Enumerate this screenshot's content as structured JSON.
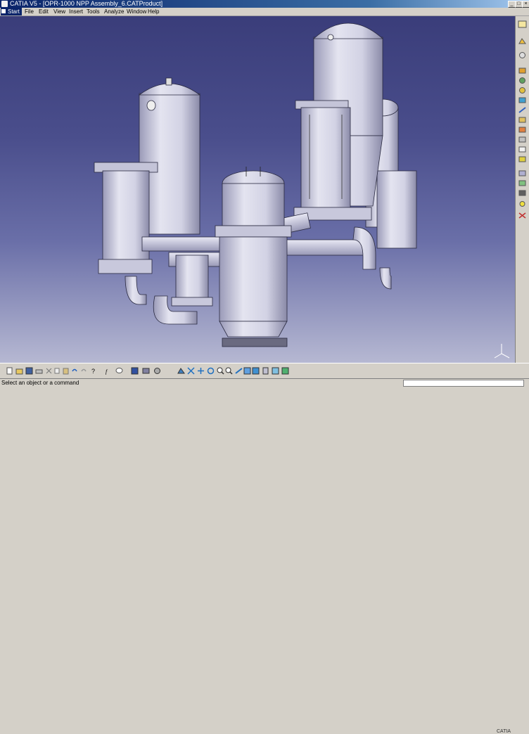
{
  "window": {
    "title": "CATIA V5 - [OPR-1000 NPP Assembly_6.CATProduct]",
    "controls": [
      "_",
      "□",
      "×"
    ]
  },
  "menubar": {
    "items": [
      "Start",
      "File",
      "Edit",
      "View",
      "Insert",
      "Tools",
      "Analyze",
      "Window",
      "Help"
    ]
  },
  "toolbar_right": {
    "icons": [
      "sketcher-icon",
      "part-design-icon",
      "assembly-icon",
      "product-icon",
      "constraint-icon",
      "move-icon",
      "explode-icon",
      "snap-icon",
      "clash-icon",
      "section-icon",
      "distance-icon",
      "measure-icon",
      "catalog-icon",
      "scene-icon",
      "annotation-icon",
      "render-icon",
      "light-icon",
      "kinematics-icon"
    ]
  },
  "toolbar_bottom": {
    "icons": [
      "new-icon",
      "open-icon",
      "save-icon",
      "print-icon",
      "cut-icon",
      "copy-icon",
      "paste-icon",
      "undo-icon",
      "redo-icon",
      "whats-this-icon",
      "formula-icon",
      "comment-icon",
      "catalog-browser-icon",
      "show-hide-icon",
      "swap-icon",
      "fly-mode-icon",
      "fit-all-icon",
      "pan-icon",
      "rotate-icon",
      "zoom-in-icon",
      "zoom-out-icon",
      "normal-view-icon",
      "iso-view-icon",
      "shading-icon",
      "hide-show-icon",
      "swap-space-icon",
      "render-style-icon"
    ]
  },
  "status": {
    "prompt": "Select an object or a command"
  },
  "branding": {
    "logo_text": "CATIA"
  },
  "colors": {
    "title_bar": "#0a246a",
    "background_top": "#3a3d7a",
    "background_bottom": "#b6b8d2",
    "model": "#d6d6e6"
  }
}
